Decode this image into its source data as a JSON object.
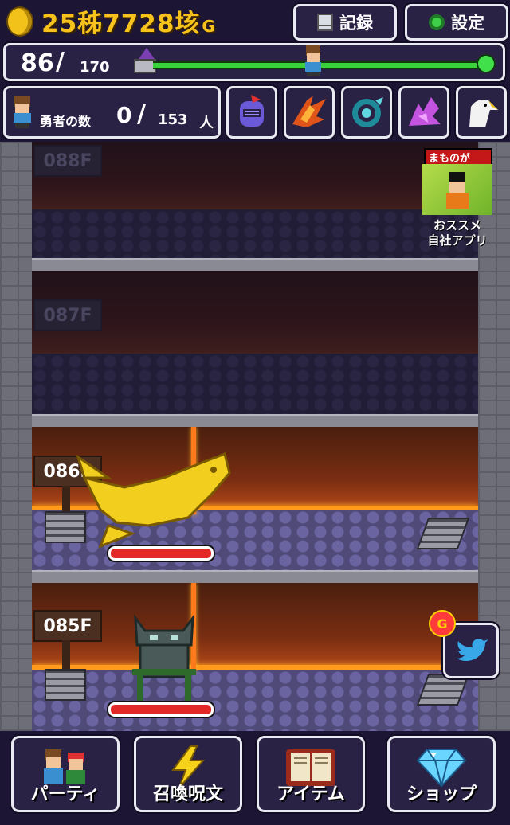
{
  "header": {
    "gold_amount": "25秭7728垓",
    "gold_unit": "G",
    "record_label": "記録",
    "settings_label": "設定"
  },
  "progress": {
    "current_floor": "86",
    "max_floor": "170"
  },
  "heroes": {
    "label": "勇者の数",
    "count": "0",
    "max": "153",
    "unit": "人"
  },
  "monster_slots": [
    "knight-helmet-icon",
    "fire-bird-icon",
    "sea-serpent-icon",
    "purple-wyvern-icon",
    "eagle-icon"
  ],
  "floors": [
    {
      "label": "088F",
      "state": "dim"
    },
    {
      "label": "087F",
      "state": "dim"
    },
    {
      "label": "086F",
      "state": "active",
      "monster": "golden-fish-monster",
      "hp_fraction": 1.0
    },
    {
      "label": "085F",
      "state": "active",
      "monster": "stone-gargoyle-monster",
      "hp_fraction": 1.0
    }
  ],
  "promo": {
    "banner": "まものが",
    "text_line1": "おススメ",
    "text_line2": "自社アプリ"
  },
  "social": {
    "badge": "G"
  },
  "nav": {
    "party": "パーティ",
    "summon": "召喚呪文",
    "items": "アイテム",
    "shop": "ショップ"
  },
  "colors": {
    "gold": "#f6c21b",
    "panel": "#2a2245",
    "progress_green": "#3bd13b",
    "hp_red": "#e32828",
    "lava": "#ff9a1a"
  }
}
